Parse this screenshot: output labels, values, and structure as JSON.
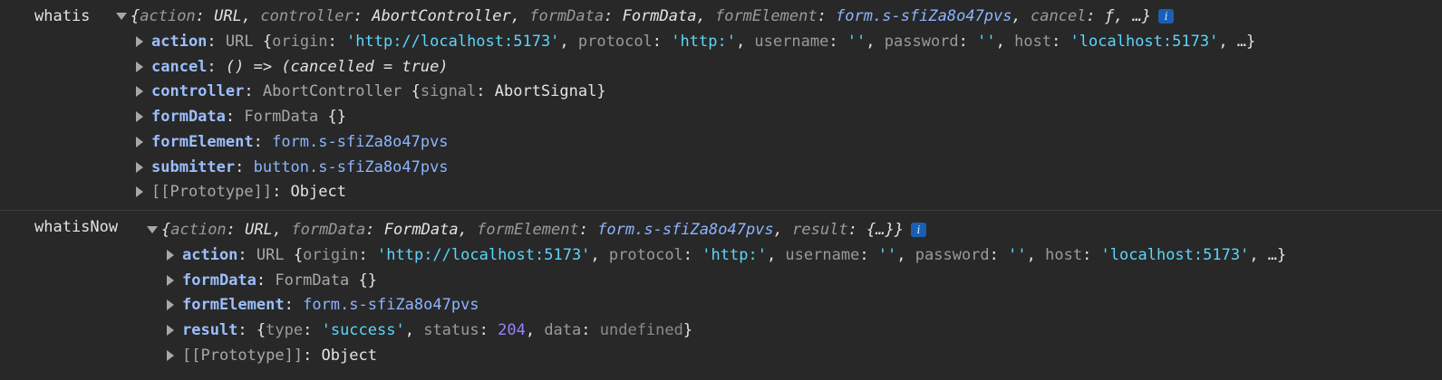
{
  "entry1": {
    "label": "whatis",
    "summary": [
      {
        "k": "action",
        "v": "URL",
        "t": "val"
      },
      {
        "k": "controller",
        "v": "AbortController",
        "t": "val"
      },
      {
        "k": "formData",
        "v": "FormData",
        "t": "val"
      },
      {
        "k": "formElement",
        "v": "form.s-sfiZa8o47pvs",
        "t": "el"
      },
      {
        "k": "cancel",
        "v": "ƒ",
        "t": "val"
      }
    ],
    "summary_tail": ", …}",
    "props": [
      {
        "key": "action",
        "segs": [
          [
            "cls",
            "URL "
          ],
          [
            "val",
            "{"
          ],
          [
            "ikey",
            "origin"
          ],
          [
            "val",
            ": "
          ],
          [
            "str",
            "'http://localhost:5173'"
          ],
          [
            "val",
            ", "
          ],
          [
            "ikey",
            "protocol"
          ],
          [
            "val",
            ": "
          ],
          [
            "str",
            "'http:'"
          ],
          [
            "val",
            ", "
          ],
          [
            "ikey",
            "username"
          ],
          [
            "val",
            ": "
          ],
          [
            "str",
            "''"
          ],
          [
            "val",
            ", "
          ],
          [
            "ikey",
            "password"
          ],
          [
            "val",
            ": "
          ],
          [
            "str",
            "''"
          ],
          [
            "val",
            ", "
          ],
          [
            "ikey",
            "host"
          ],
          [
            "val",
            ": "
          ],
          [
            "str",
            "'localhost:5173'"
          ],
          [
            "val",
            ", …}"
          ]
        ]
      },
      {
        "key": "cancel",
        "segs": [
          [
            "it",
            "() => (cancelled = true)"
          ]
        ]
      },
      {
        "key": "controller",
        "segs": [
          [
            "cls",
            "AbortController "
          ],
          [
            "val",
            "{"
          ],
          [
            "ikey",
            "signal"
          ],
          [
            "val",
            ": AbortSignal}"
          ]
        ]
      },
      {
        "key": "formData",
        "segs": [
          [
            "cls",
            "FormData "
          ],
          [
            "val",
            "{}"
          ]
        ]
      },
      {
        "key": "formElement",
        "segs": [
          [
            "el",
            "form.s-sfiZa8o47pvs"
          ]
        ]
      },
      {
        "key": "submitter",
        "segs": [
          [
            "el",
            "button.s-sfiZa8o47pvs"
          ]
        ]
      },
      {
        "key": "[[Prototype]]",
        "proto": true,
        "segs": [
          [
            "val",
            "Object"
          ]
        ]
      }
    ]
  },
  "entry2": {
    "label": "whatisNow",
    "summary": [
      {
        "k": "action",
        "v": "URL",
        "t": "val"
      },
      {
        "k": "formData",
        "v": "FormData",
        "t": "val"
      },
      {
        "k": "formElement",
        "v": "form.s-sfiZa8o47pvs",
        "t": "el"
      },
      {
        "k": "result",
        "v": "{…}",
        "t": "val"
      }
    ],
    "summary_tail": "}",
    "props": [
      {
        "key": "action",
        "segs": [
          [
            "cls",
            "URL "
          ],
          [
            "val",
            "{"
          ],
          [
            "ikey",
            "origin"
          ],
          [
            "val",
            ": "
          ],
          [
            "str",
            "'http://localhost:5173'"
          ],
          [
            "val",
            ", "
          ],
          [
            "ikey",
            "protocol"
          ],
          [
            "val",
            ": "
          ],
          [
            "str",
            "'http:'"
          ],
          [
            "val",
            ", "
          ],
          [
            "ikey",
            "username"
          ],
          [
            "val",
            ": "
          ],
          [
            "str",
            "''"
          ],
          [
            "val",
            ", "
          ],
          [
            "ikey",
            "password"
          ],
          [
            "val",
            ": "
          ],
          [
            "str",
            "''"
          ],
          [
            "val",
            ", "
          ],
          [
            "ikey",
            "host"
          ],
          [
            "val",
            ": "
          ],
          [
            "str",
            "'localhost:5173'"
          ],
          [
            "val",
            ", …}"
          ]
        ]
      },
      {
        "key": "formData",
        "segs": [
          [
            "cls",
            "FormData "
          ],
          [
            "val",
            "{}"
          ]
        ]
      },
      {
        "key": "formElement",
        "segs": [
          [
            "el",
            "form.s-sfiZa8o47pvs"
          ]
        ]
      },
      {
        "key": "result",
        "segs": [
          [
            "val",
            "{"
          ],
          [
            "ikey",
            "type"
          ],
          [
            "val",
            ": "
          ],
          [
            "str",
            "'success'"
          ],
          [
            "val",
            ", "
          ],
          [
            "ikey",
            "status"
          ],
          [
            "val",
            ": "
          ],
          [
            "num",
            "204"
          ],
          [
            "val",
            ", "
          ],
          [
            "ikey",
            "data"
          ],
          [
            "val",
            ": "
          ],
          [
            "undef",
            "undefined"
          ],
          [
            "val",
            "}"
          ]
        ]
      },
      {
        "key": "[[Prototype]]",
        "proto": true,
        "segs": [
          [
            "val",
            "Object"
          ]
        ]
      }
    ]
  },
  "info_glyph": "i",
  "icons": [
    "expand-arrow-icon",
    "collapsed-arrow-icon",
    "info-icon"
  ]
}
